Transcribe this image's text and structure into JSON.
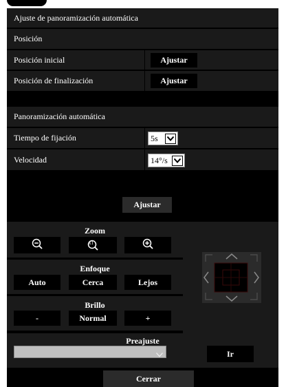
{
  "title": "Ajuste de panoramización automática",
  "section_position": "Posición",
  "start_position": {
    "label": "Posición inicial",
    "button": "Ajustar"
  },
  "end_position": {
    "label": "Posición de finalización",
    "button": "Ajustar"
  },
  "section_autopan": "Panoramización automática",
  "dwell_time": {
    "label": "Tiempo de fijación",
    "value": "5s"
  },
  "speed": {
    "label": "Velocidad",
    "value": "14°/s"
  },
  "set_button": "Ajustar",
  "zoom": {
    "title": "Zoom",
    "reset": "x1"
  },
  "focus": {
    "title": "Enfoque",
    "auto": "Auto",
    "near": "Cerca",
    "far": "Lejos"
  },
  "brightness": {
    "title": "Brillo",
    "minus": "-",
    "normal": "Normal",
    "plus": "+"
  },
  "preset": {
    "title": "Preajuste",
    "value": "",
    "go_button": "Ir"
  },
  "close_button": "Cerrar",
  "icons": [
    "zoom-out-icon",
    "zoom-reset-icon",
    "zoom-in-icon",
    "ptz-up-icon",
    "ptz-down-icon",
    "ptz-left-icon",
    "ptz-right-icon"
  ]
}
